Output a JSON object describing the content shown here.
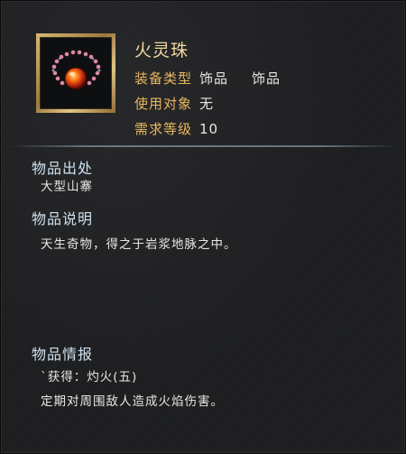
{
  "item": {
    "name": "火灵珠",
    "icon": "fire-bead-necklace-icon",
    "attributes": [
      {
        "key": "装备类型",
        "value": "饰品",
        "value2": "饰品"
      },
      {
        "key": "使用对象",
        "value": "无"
      },
      {
        "key": "需求等级",
        "value": "10"
      }
    ]
  },
  "sections": {
    "source": {
      "title": "物品出处",
      "text": "大型山寨"
    },
    "description": {
      "title": "物品说明",
      "text": "天生奇物，得之于岩浆地脉之中。"
    },
    "info": {
      "title": "物品情报",
      "lines": [
        "`获得：灼火(五)",
        "定期对周围敌人造成火焰伤害。"
      ]
    }
  },
  "colors": {
    "name": "#f2d9a0",
    "attr_key": "#e8b75f",
    "section_title": "#cfe1ef",
    "text": "#eae7e0",
    "frame_gold": "#c9a862"
  }
}
